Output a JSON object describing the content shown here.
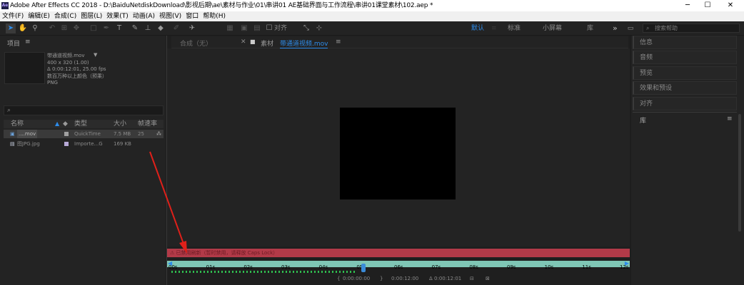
{
  "window": {
    "title": "Adobe After Effects CC 2018 - D:\\BaiduNetdiskDownload\\影视后期\\ae\\素材与作业\\01\\串讲01  AE基础界面与工作流程\\串讲01课堂素材\\102.aep *",
    "app_icon": "Ae",
    "minimize": "─",
    "maximize": "☐",
    "close": "✕"
  },
  "menu": [
    "文件(F)",
    "编辑(E)",
    "合成(C)",
    "图层(L)",
    "效果(T)",
    "动画(A)",
    "视图(V)",
    "窗口",
    "帮助(H)"
  ],
  "toolbar": {
    "align_label": "对齐",
    "workspaces": [
      "默认",
      "标准",
      "小屏幕",
      "库"
    ],
    "active_workspace": "默认",
    "more": "»",
    "search_placeholder": "搜索帮助"
  },
  "project": {
    "title": "项目",
    "menu_icon": "≡",
    "item_name": "带通道视频.mov",
    "item_dropdown": "▼",
    "item_size": "400 x 320 (1.00)",
    "item_duration": "Δ 0:00:12:01, 25.00 fps",
    "item_colors": "数百万种以上颜色（预乘）",
    "item_codec": "PNG",
    "search_icon": "⌕",
    "columns": {
      "name": "名称",
      "type": "类型",
      "size": "大小",
      "fps": "帧速率"
    },
    "rows": [
      {
        "name": "....mov",
        "type": "QuickTime",
        "size": "7.5 MB",
        "fps": "25"
      },
      {
        "name": "图JPG.jpg",
        "type": "Importe...G",
        "size": "169 KB",
        "fps": ""
      }
    ]
  },
  "viewer": {
    "comp_tab": "合成（无）",
    "footage_tab_prefix": "素材",
    "footage_tab_name": "带通道视频.mov",
    "tab_menu": "≡",
    "warning": "⚠ 已禁用刷新（暂时禁用，请释放 Caps Lock）"
  },
  "timeline": {
    "ticks": [
      "00s",
      "01s",
      "02s",
      "03s",
      "04s",
      "05s",
      "06s",
      "07s",
      "08s",
      "09s",
      "10s",
      "11s",
      "12s"
    ],
    "current_time": "0:00:00:00",
    "end_time": "0:00:12:00",
    "duration": "Δ 0:00:12:01"
  },
  "right_panel": {
    "items": [
      "信息",
      "音频",
      "预览",
      "效果和预设",
      "对齐"
    ],
    "library": "库",
    "library_menu": "≡"
  },
  "colors": {
    "accent": "#2d8ceb",
    "warning_bar": "#b23a48",
    "timeline_bar": "#7fc6b5",
    "annotation_arrow": "#e0201a"
  }
}
